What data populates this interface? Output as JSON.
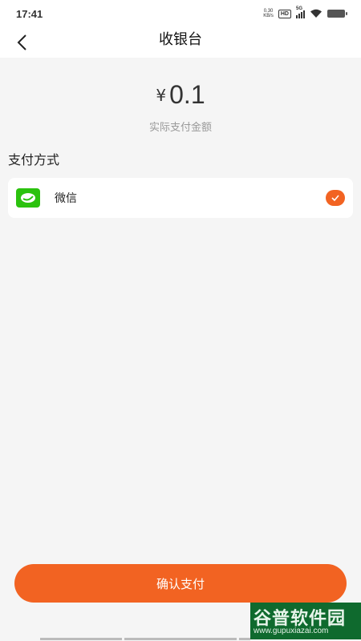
{
  "status_bar": {
    "time": "17:41",
    "net_speed_value": "0.30",
    "net_speed_unit": "KB/s",
    "hd": "HD",
    "network": "5G",
    "icons": [
      "hd-icon",
      "signal-icon",
      "wifi-icon",
      "battery-icon"
    ]
  },
  "nav": {
    "back_icon": "chevron-left-icon",
    "title": "收银台"
  },
  "payment": {
    "currency": "¥",
    "amount": "0.1",
    "amount_caption": "实际支付金额"
  },
  "methods": {
    "section_title": "支付方式",
    "items": [
      {
        "label": "微信",
        "icon": "wechat-icon",
        "selected": true
      }
    ]
  },
  "actions": {
    "confirm_label": "确认支付"
  },
  "watermark": {
    "brand": "谷普软件园",
    "url": "www.gupuxiazai.com"
  },
  "colors": {
    "accent": "#f26322",
    "wechat_green": "#2bc20e",
    "background": "#f5f5f5",
    "card": "#ffffff"
  }
}
